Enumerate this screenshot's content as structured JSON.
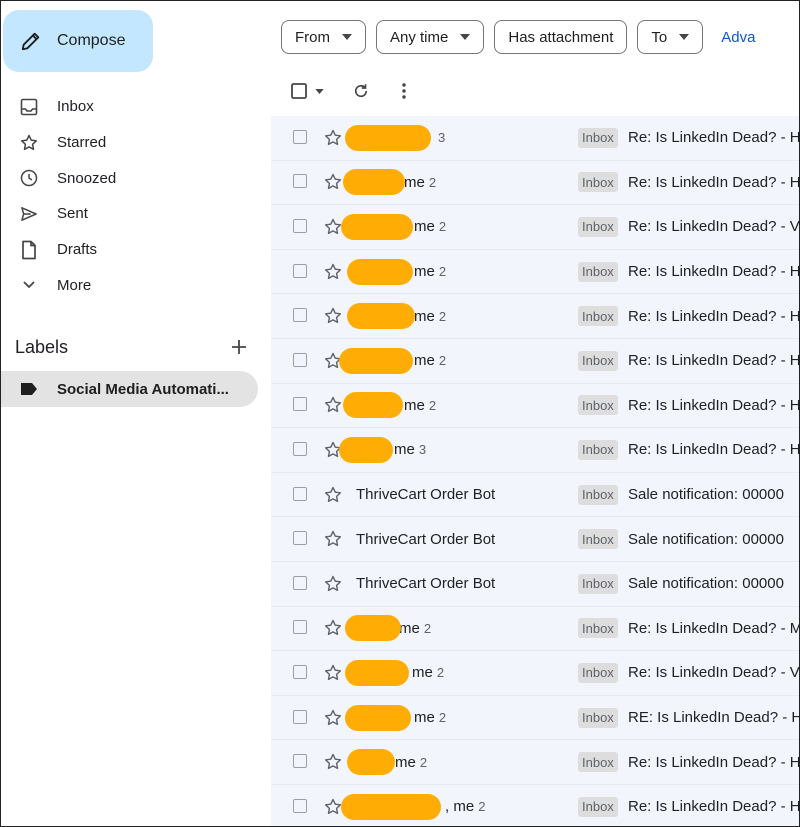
{
  "sidebar": {
    "compose_label": "Compose",
    "nav": [
      {
        "label": "Inbox",
        "icon": "inbox-icon"
      },
      {
        "label": "Starred",
        "icon": "star-icon"
      },
      {
        "label": "Snoozed",
        "icon": "clock-icon"
      },
      {
        "label": "Sent",
        "icon": "send-icon"
      },
      {
        "label": "Drafts",
        "icon": "draft-icon"
      },
      {
        "label": "More",
        "icon": "chevron-down-icon"
      }
    ],
    "labels_title": "Labels",
    "label_items": [
      {
        "label": "Social Media Automati..."
      }
    ]
  },
  "filters": {
    "from": "From",
    "any_time": "Any time",
    "has_attachment": "Has attachment",
    "to": "To",
    "advanced": "Adva"
  },
  "colors": {
    "compose_bg": "#c2e7ff",
    "selected_label_bg": "#e3e3e3",
    "row_bg": "#f2f6fc",
    "redaction": "#ffad05",
    "link": "#0b57d0"
  },
  "emails": [
    {
      "sender": "",
      "count": "3",
      "tag": "Inbox",
      "subject": "Re: Is LinkedIn Dead? - H",
      "redacted": true
    },
    {
      "sender": "me",
      "count": "2",
      "tag": "Inbox",
      "subject": "Re: Is LinkedIn Dead? - H",
      "redacted": true
    },
    {
      "sender": "me",
      "count": "2",
      "tag": "Inbox",
      "subject": "Re: Is LinkedIn Dead? - V",
      "redacted": true
    },
    {
      "sender": "me",
      "count": "2",
      "tag": "Inbox",
      "subject": "Re: Is LinkedIn Dead? - H",
      "redacted": true
    },
    {
      "sender": "me",
      "count": "2",
      "tag": "Inbox",
      "subject": "Re: Is LinkedIn Dead? - H",
      "redacted": true
    },
    {
      "sender": "me",
      "count": "2",
      "tag": "Inbox",
      "subject": "Re: Is LinkedIn Dead? - H",
      "redacted": true
    },
    {
      "sender": "me",
      "count": "2",
      "tag": "Inbox",
      "subject": "Re: Is LinkedIn Dead? - H",
      "redacted": true
    },
    {
      "sender": "me",
      "count": "3",
      "tag": "Inbox",
      "subject": "Re: Is LinkedIn Dead? - H",
      "redacted": true
    },
    {
      "sender": "ThriveCart Order Bot",
      "count": "",
      "tag": "Inbox",
      "subject": "Sale notification: 00000",
      "redacted": false
    },
    {
      "sender": "ThriveCart Order Bot",
      "count": "",
      "tag": "Inbox",
      "subject": "Sale notification: 00000",
      "redacted": false
    },
    {
      "sender": "ThriveCart Order Bot",
      "count": "",
      "tag": "Inbox",
      "subject": "Sale notification: 00000",
      "redacted": false
    },
    {
      "sender": "me",
      "count": "2",
      "tag": "Inbox",
      "subject": "Re: Is LinkedIn Dead? - M",
      "redacted": true
    },
    {
      "sender": "me",
      "count": "2",
      "tag": "Inbox",
      "subject": "Re: Is LinkedIn Dead? - V",
      "redacted": true
    },
    {
      "sender": "me",
      "count": "2",
      "tag": "Inbox",
      "subject": "RE: Is LinkedIn Dead? - H",
      "redacted": true
    },
    {
      "sender": "me",
      "count": "2",
      "tag": "Inbox",
      "subject": "Re: Is LinkedIn Dead? - H",
      "redacted": true
    },
    {
      "sender": ", me",
      "count": "2",
      "tag": "Inbox",
      "subject": "Re: Is LinkedIn Dead? - H",
      "redacted": true
    }
  ]
}
